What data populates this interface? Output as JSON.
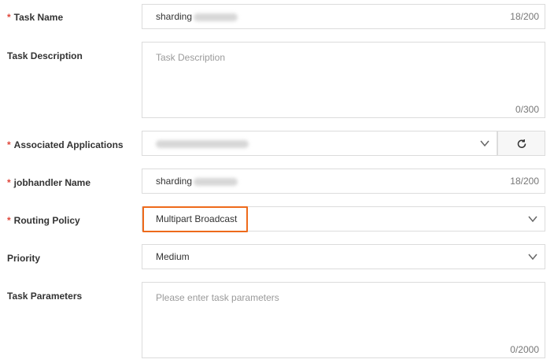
{
  "form": {
    "task_name": {
      "label": "Task Name",
      "required": "*",
      "value": "sharding",
      "count": "18/200"
    },
    "task_description": {
      "label": "Task Description",
      "placeholder": "Task Description",
      "count": "0/300"
    },
    "associated_applications": {
      "label": "Associated Applications",
      "required": "*",
      "value": ""
    },
    "jobhandler_name": {
      "label": "jobhandler Name",
      "required": "*",
      "value": "sharding",
      "count": "18/200"
    },
    "routing_policy": {
      "label": "Routing Policy",
      "required": "*",
      "value": "Multipart Broadcast"
    },
    "priority": {
      "label": "Priority",
      "value": "Medium"
    },
    "task_parameters": {
      "label": "Task Parameters",
      "placeholder": "Please enter task parameters",
      "count": "0/2000"
    }
  },
  "colors": {
    "required_star": "#e0473b",
    "highlight_border": "#ee6a1b",
    "field_border": "#dcdcdc"
  },
  "icons": {
    "dropdown": "chevron-down-icon",
    "refresh": "refresh-icon"
  }
}
